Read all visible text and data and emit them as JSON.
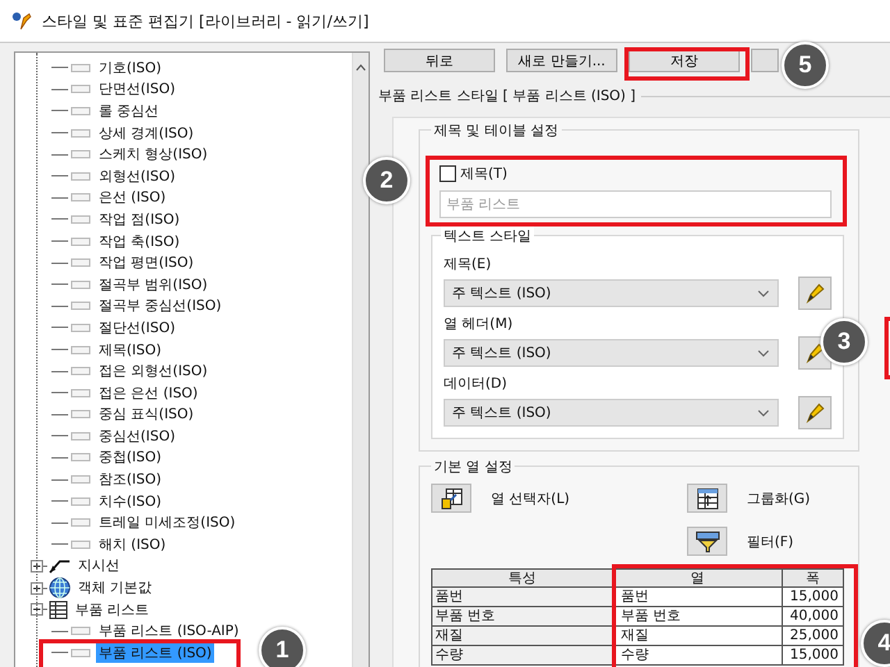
{
  "window": {
    "title": "스타일 및 표준 편집기 [라이브러리 - 읽기/쓰기]"
  },
  "tree": {
    "partial_children": [
      {
        "label": "기호(ISO)",
        "selected": false
      },
      {
        "label": "단면선(ISO)",
        "selected": false
      },
      {
        "label": "롤 중심선",
        "selected": false
      },
      {
        "label": "상세 경계(ISO)",
        "selected": false
      },
      {
        "label": "스케치 형상(ISO)",
        "selected": false
      },
      {
        "label": "외형선(ISO)",
        "selected": false
      },
      {
        "label": "은선 (ISO)",
        "selected": false
      },
      {
        "label": "작업 점(ISO)",
        "selected": false
      },
      {
        "label": "작업 축(ISO)",
        "selected": false
      },
      {
        "label": "작업 평면(ISO)",
        "selected": false
      },
      {
        "label": "절곡부 범위(ISO)",
        "selected": false
      },
      {
        "label": "절곡부 중심선(ISO)",
        "selected": false
      },
      {
        "label": "절단선(ISO)",
        "selected": false
      },
      {
        "label": "제목(ISO)",
        "selected": false
      },
      {
        "label": "접은 외형선(ISO)",
        "selected": false
      },
      {
        "label": "접은 은선 (ISO)",
        "selected": false
      },
      {
        "label": "중심 표식(ISO)",
        "selected": false
      },
      {
        "label": "중심선(ISO)",
        "selected": false
      },
      {
        "label": "중첩(ISO)",
        "selected": false
      },
      {
        "label": "참조(ISO)",
        "selected": false
      },
      {
        "label": "치수(ISO)",
        "selected": false
      },
      {
        "label": "트레일 미세조정(ISO)",
        "selected": false
      },
      {
        "label": "해치 (ISO)",
        "selected": false
      }
    ],
    "items": [
      {
        "label": "지시선",
        "kind": "leader",
        "expanded": false
      },
      {
        "label": "객체 기본값",
        "kind": "globe",
        "expanded": false
      },
      {
        "label": "부품 리스트",
        "kind": "table",
        "expanded": true,
        "children": [
          {
            "label": "부품 리스트 (ISO-AIP)",
            "selected": false
          },
          {
            "label": "부품 리스트 (ISO)",
            "selected": true
          }
        ]
      }
    ]
  },
  "toolbar": {
    "buttons": [
      "뒤로",
      "새로 만들기...",
      "저장"
    ]
  },
  "style_heading": "부품 리스트 스타일 [ 부품 리스트 (ISO) ]",
  "title_group": {
    "legend": "제목 및 테이블 설정",
    "title_checkbox": {
      "label": "제목(T)",
      "checked": false
    },
    "title_field": {
      "value": "부품 리스트",
      "disabled": true
    },
    "text_style": {
      "legend": "텍스트 스타일",
      "rows": [
        {
          "label": "제목(E)",
          "value": "주 텍스트 (ISO)"
        },
        {
          "label": "열 헤더(M)",
          "value": "주 텍스트 (ISO)"
        },
        {
          "label": "데이터(D)",
          "value": "주 텍스트 (ISO)"
        }
      ]
    }
  },
  "column_group": {
    "legend": "기본 열 설정",
    "buttons": [
      {
        "label": "열 선택자(L)",
        "kind": "chooser"
      },
      {
        "label": "그룹화(G)",
        "kind": "group"
      },
      {
        "label": "필터(F)",
        "kind": "filter"
      }
    ],
    "table": {
      "columns": [
        "특성",
        "열",
        "폭"
      ],
      "rows": [
        [
          "품번",
          "품번",
          "15,000"
        ],
        [
          "부품 번호",
          "부품 번호",
          "40,000"
        ],
        [
          "재질",
          "재질",
          "25,000"
        ],
        [
          "수량",
          "수량",
          "15,000"
        ]
      ]
    }
  },
  "callouts": [
    "1",
    "2",
    "3",
    "4",
    "5"
  ]
}
